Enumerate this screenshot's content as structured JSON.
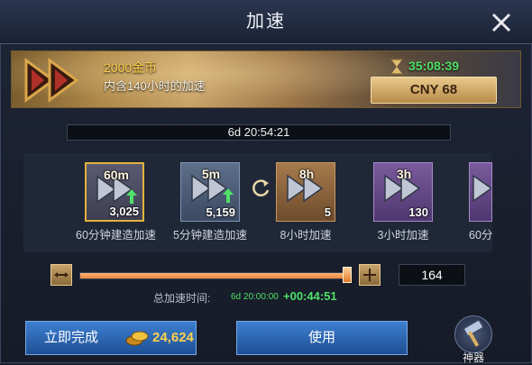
{
  "dialog": {
    "title": "加速"
  },
  "banner": {
    "gold_title": "2000金币",
    "gold_sub": "内含140小时的加速",
    "timer": "35:08:39",
    "price": "CNY 68"
  },
  "remaining_time": "6d 20:54:21",
  "items": [
    {
      "label": "60m",
      "count": "3,025",
      "name": "60分钟建造加速",
      "icon": "speedup-60m-icon"
    },
    {
      "label": "5m",
      "count": "5,159",
      "name": "5分钟建造加速",
      "icon": "speedup-5m-icon"
    },
    {
      "label": "8h",
      "count": "5",
      "name": "8小时加速",
      "icon": "speedup-8h-icon"
    },
    {
      "label": "3h",
      "count": "130",
      "name": "3小时加速",
      "icon": "speedup-3h-icon"
    },
    {
      "label": "",
      "count": "",
      "name": "60分",
      "icon": "speedup-partial-icon"
    }
  ],
  "slider": {
    "quantity": "164",
    "fill_fraction": 0.99
  },
  "total": {
    "label": "总加速时间:",
    "base": "6d 20:00:00",
    "added": "+00:44:51"
  },
  "actions": {
    "finish_label": "立即完成",
    "finish_cost": "24,624",
    "use_label": "使用"
  },
  "artifact": {
    "label": "神器"
  },
  "colors": {
    "accent_green": "#4fe068",
    "gold": "#ffd04a",
    "button_blue": "#2f68b8"
  }
}
